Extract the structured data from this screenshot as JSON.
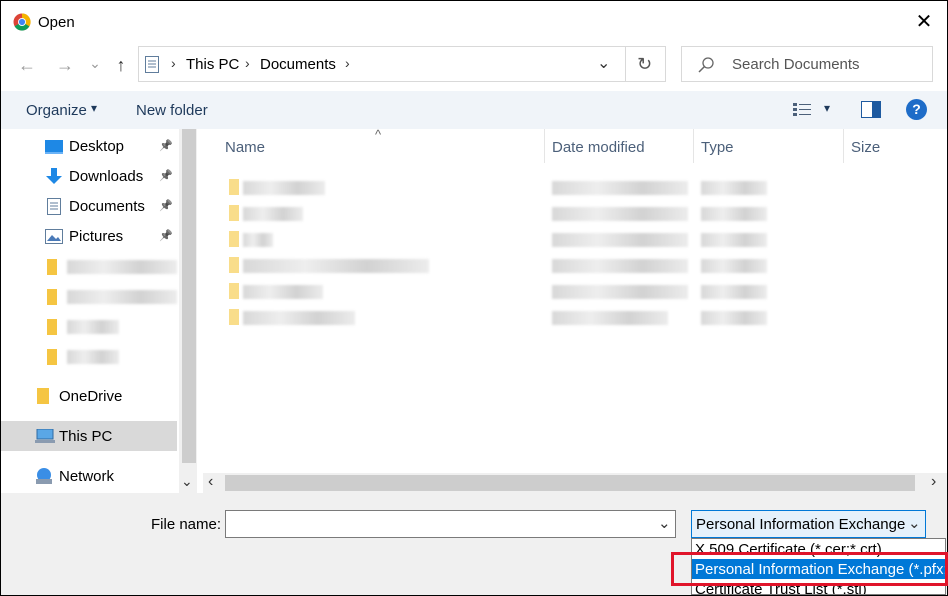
{
  "window": {
    "title": "Open",
    "close_label": "✕"
  },
  "nav": {
    "back": "←",
    "forward": "→",
    "recent": "⌄",
    "up": "↑"
  },
  "address": {
    "crumbs": [
      "This PC",
      "Documents"
    ],
    "separator": "›",
    "dropdown": "⌄",
    "refresh": "↻"
  },
  "search": {
    "placeholder": "Search Documents"
  },
  "toolbar": {
    "organize": "Organize",
    "organize_arrow": "▾",
    "new_folder": "New folder",
    "view_arrow": "▾",
    "help": "?"
  },
  "sidebar": {
    "items": [
      {
        "label": "Desktop",
        "icon": "desktop-icon",
        "pinned": true
      },
      {
        "label": "Downloads",
        "icon": "downloads-icon",
        "pinned": true
      },
      {
        "label": "Documents",
        "icon": "documents-icon",
        "pinned": true
      },
      {
        "label": "Pictures",
        "icon": "pictures-icon",
        "pinned": true
      },
      {
        "label": "OneDrive",
        "icon": "onedrive-icon"
      },
      {
        "label": "This PC",
        "icon": "this-pc-icon",
        "selected": true
      },
      {
        "label": "Network",
        "icon": "network-icon"
      }
    ],
    "pin_glyph": "📌",
    "scroll_down": "⌄"
  },
  "columns": {
    "name": "Name",
    "date_modified": "Date modified",
    "type": "Type",
    "size": "Size",
    "sort_indicator": "^"
  },
  "hscroll": {
    "left": "‹",
    "right": "›"
  },
  "file_name": {
    "label": "File name:",
    "value": "",
    "dropdown": "⌄"
  },
  "file_type": {
    "selected": "Personal Information Exchange",
    "dropdown": "⌄",
    "options": [
      "X.509 Certificate (*.cer;*.crt)",
      "Personal Information Exchange (*.pfx;",
      "Certificate Trust List (*.stl)"
    ]
  },
  "colors": {
    "accent": "#0078d7",
    "highlight_box": "#e0142a",
    "folder": "#f5c542"
  }
}
